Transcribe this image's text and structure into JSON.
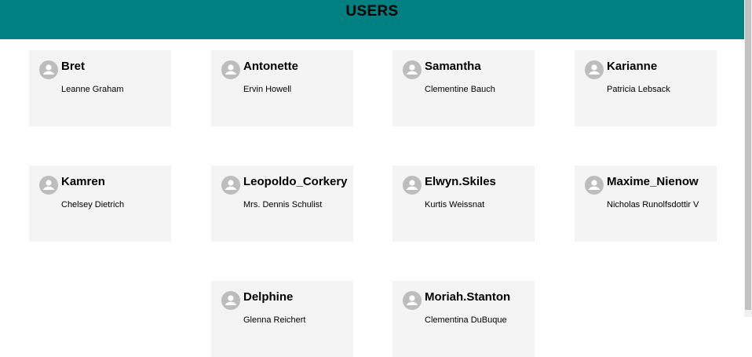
{
  "header": {
    "title": "USERS"
  },
  "colors": {
    "header_bg": "#008080",
    "card_bg": "#f4f4f4",
    "avatar": "#bdbdbd"
  },
  "users": [
    {
      "username": "Bret",
      "name": "Leanne Graham",
      "icon": "user-avatar-icon"
    },
    {
      "username": "Antonette",
      "name": "Ervin Howell",
      "icon": "user-avatar-icon"
    },
    {
      "username": "Samantha",
      "name": "Clementine Bauch",
      "icon": "user-avatar-icon"
    },
    {
      "username": "Karianne",
      "name": "Patricia Lebsack",
      "icon": "user-avatar-icon"
    },
    {
      "username": "Kamren",
      "name": "Chelsey Dietrich",
      "icon": "user-avatar-icon"
    },
    {
      "username": "Leopoldo_Corkery",
      "name": "Mrs. Dennis Schulist",
      "icon": "user-avatar-icon"
    },
    {
      "username": "Elwyn.Skiles",
      "name": "Kurtis Weissnat",
      "icon": "user-avatar-icon"
    },
    {
      "username": "Maxime_Nienow",
      "name": "Nicholas Runolfsdottir V",
      "icon": "user-avatar-icon"
    },
    {
      "username": "Delphine",
      "name": "Glenna Reichert",
      "icon": "user-avatar-icon"
    },
    {
      "username": "Moriah.Stanton",
      "name": "Clementina DuBuque",
      "icon": "user-avatar-icon"
    }
  ]
}
